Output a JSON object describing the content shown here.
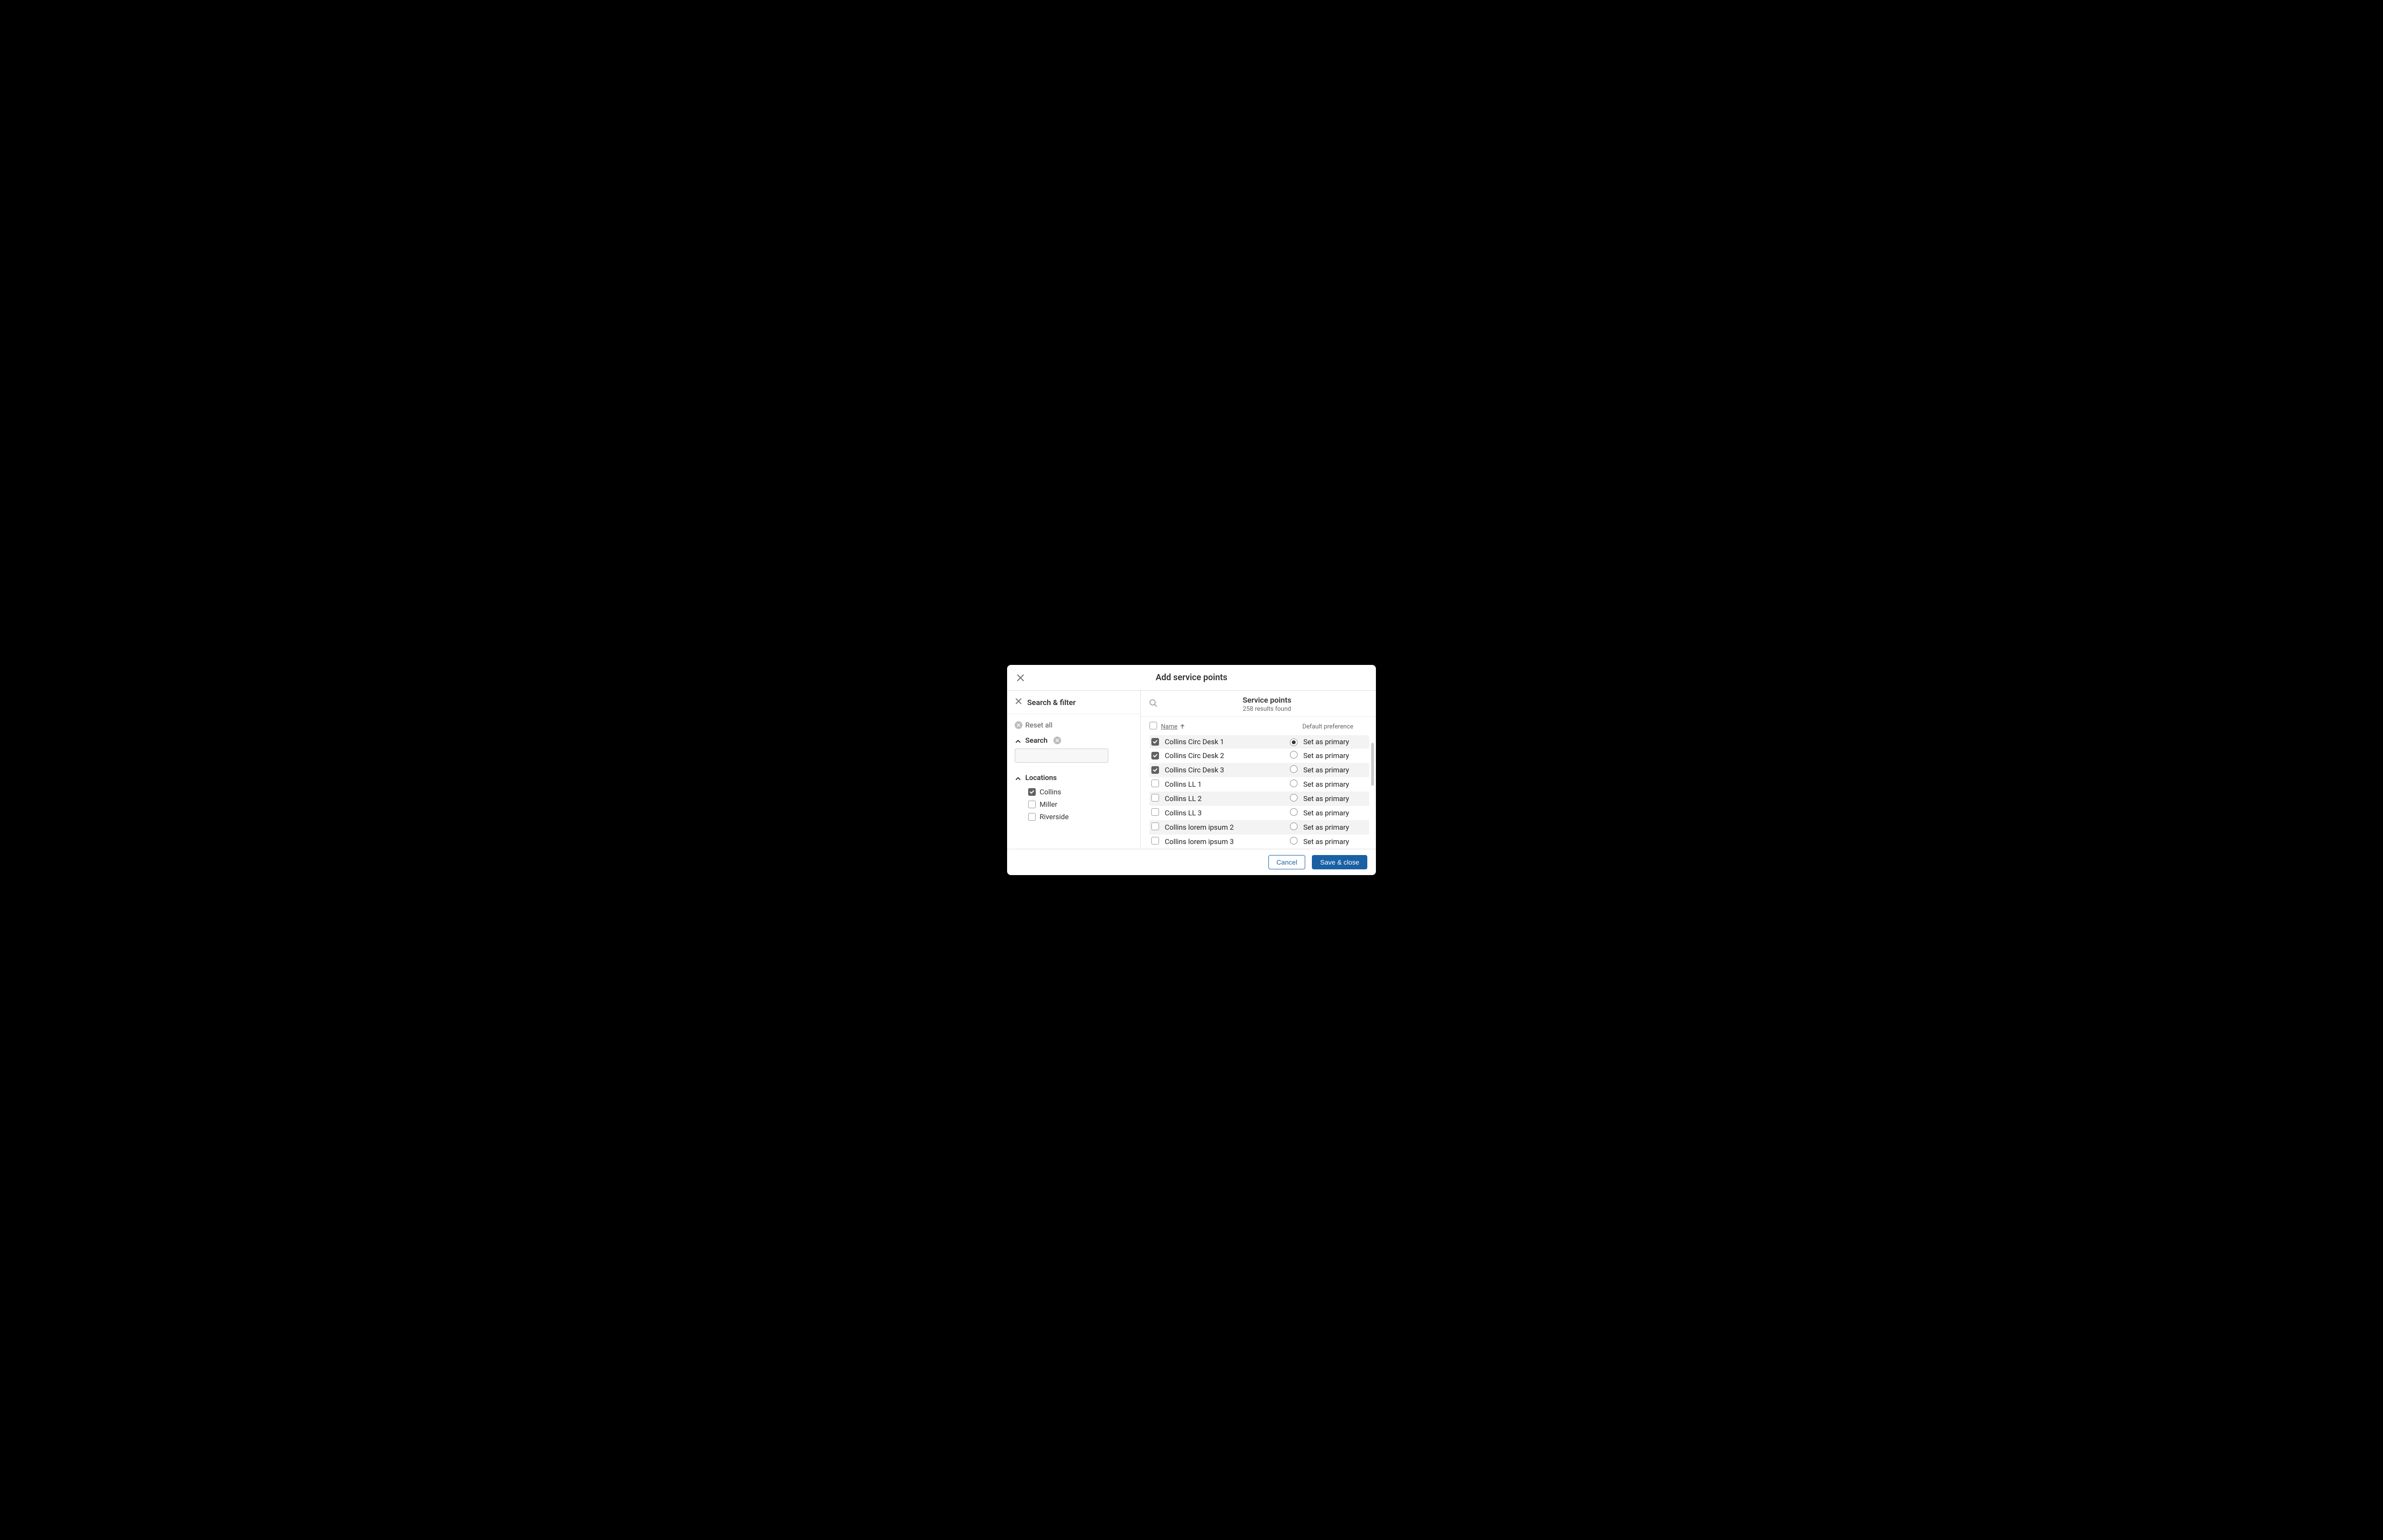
{
  "dialog": {
    "title": "Add service points"
  },
  "filter": {
    "header": "Search & filter",
    "reset": "Reset all",
    "search_label": "Search",
    "search_value": "",
    "locations_label": "Locations",
    "locations": [
      {
        "label": "Collins",
        "checked": true
      },
      {
        "label": "Miller",
        "checked": false
      },
      {
        "label": "Riverside",
        "checked": false
      }
    ]
  },
  "results": {
    "title": "Service points",
    "count_text": "258 results found",
    "columns": {
      "name": "Name",
      "preference": "Default preference"
    },
    "set_primary_label": "Set as primary",
    "rows": [
      {
        "name": "Collins Circ Desk 1",
        "checked": true,
        "primary": true
      },
      {
        "name": "Collins Circ Desk 2",
        "checked": true,
        "primary": false
      },
      {
        "name": "Collins Circ Desk 3",
        "checked": true,
        "primary": false
      },
      {
        "name": "Collins LL 1",
        "checked": false,
        "primary": false
      },
      {
        "name": "Collins LL 2",
        "checked": false,
        "primary": false
      },
      {
        "name": "Collins LL 3",
        "checked": false,
        "primary": false
      },
      {
        "name": "Collins lorem ipsum 2",
        "checked": false,
        "primary": false
      },
      {
        "name": "Collins lorem ipsum 3",
        "checked": false,
        "primary": false
      }
    ]
  },
  "footer": {
    "cancel": "Cancel",
    "save": "Save & close"
  }
}
